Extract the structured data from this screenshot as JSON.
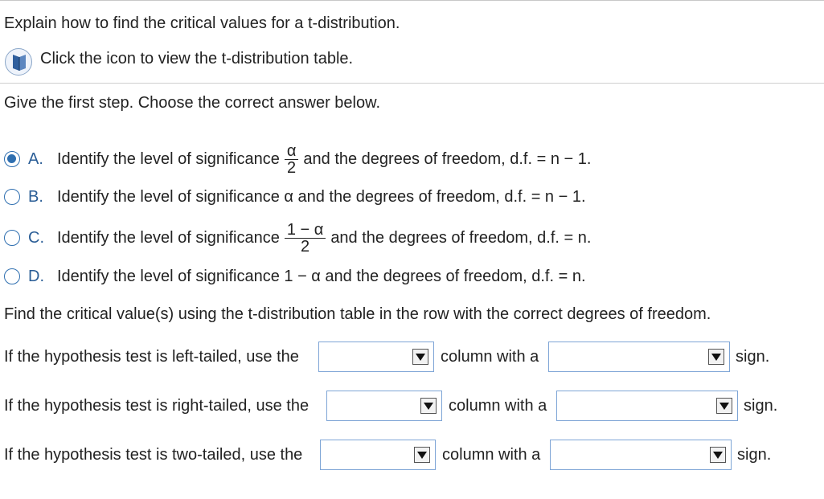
{
  "question": {
    "prompt": "Explain how to find the critical values for a t-distribution.",
    "icon_hint": "Click the icon to view the t-distribution table.",
    "icon": "book-icon"
  },
  "step1": {
    "instruction": "Give the first step. Choose the correct answer below.",
    "selected": "A",
    "options": [
      {
        "letter": "A.",
        "before": "Identify the level of significance",
        "frac_num": "α",
        "frac_den": "2",
        "after": "and the degrees of freedom, d.f. = n − 1."
      },
      {
        "letter": "B.",
        "text": "Identify the level of significance α and the degrees of freedom, d.f. = n − 1."
      },
      {
        "letter": "C.",
        "before": "Identify the level of significance",
        "frac_num": "1 − α",
        "frac_den": "2",
        "after": "and the degrees of freedom, d.f. = n."
      },
      {
        "letter": "D.",
        "text": "Identify the level of significance 1 − α and the degrees of freedom, d.f. = n."
      }
    ]
  },
  "step2": {
    "instruction": "Find the critical value(s) using the t-distribution table in the row with the correct degrees of freedom.",
    "rows": [
      {
        "lead": "If the hypothesis test is left-tailed, use the",
        "column_value": "",
        "middle": "column with a",
        "sign_value": "",
        "tail": "sign."
      },
      {
        "lead": "If the hypothesis test is right-tailed, use the",
        "column_value": "",
        "middle": "column with a",
        "sign_value": "",
        "tail": "sign."
      },
      {
        "lead": "If the hypothesis test is two-tailed, use the",
        "column_value": "",
        "middle": "column with a",
        "sign_value": "",
        "tail": "sign."
      }
    ]
  },
  "colors": {
    "accent": "#2f6fb0",
    "dropdown_border": "#7ea5d6",
    "letter": "#2a5d96"
  }
}
